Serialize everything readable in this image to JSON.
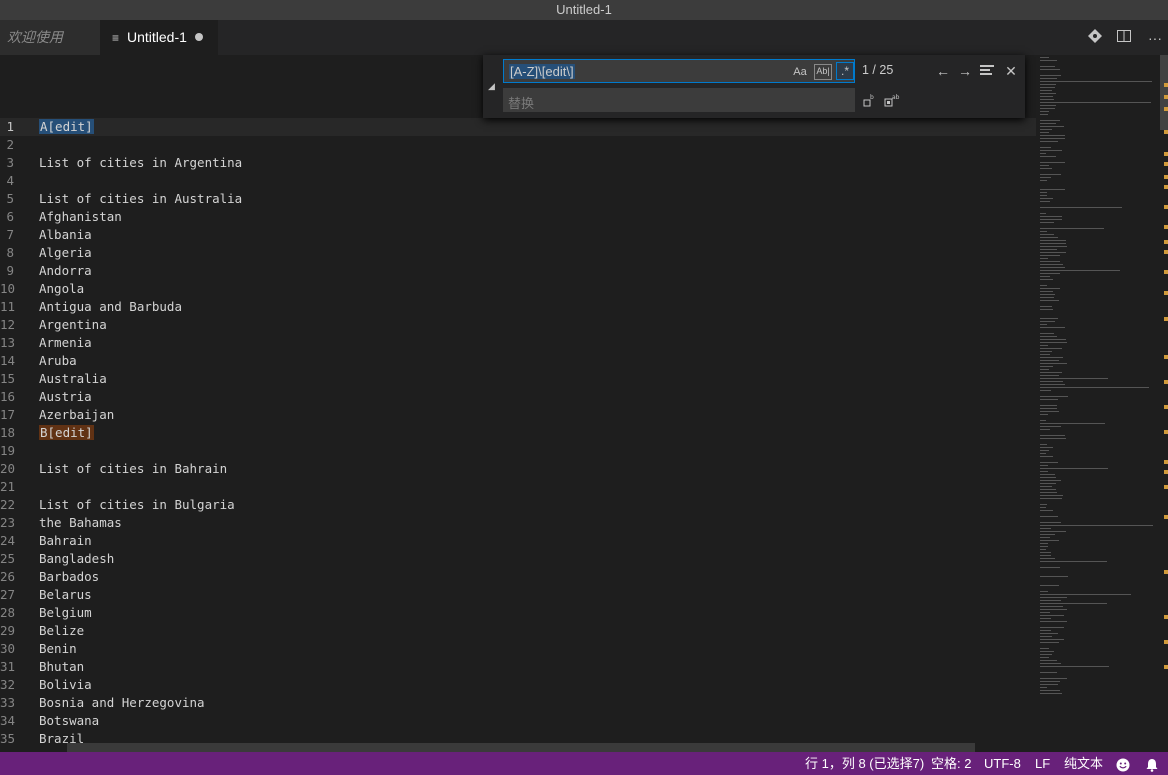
{
  "window": {
    "title": "Untitled-1"
  },
  "tabs": [
    {
      "label": "欢迎使用",
      "active": false
    },
    {
      "label": "Untitled-1",
      "active": true,
      "dirty": true
    }
  ],
  "tab_actions": [
    "source-control-icon",
    "split-editor-icon",
    "more-actions-icon"
  ],
  "find": {
    "query": "[A-Z]\\[edit\\]",
    "match_case_label": "Aa",
    "whole_word_label": "Ab|",
    "regex_label": ".*",
    "count": "1 / 25",
    "replace_placeholder": "替换"
  },
  "editor": {
    "lines": [
      "A[edit]",
      "",
      "List of cities in Argentina",
      "",
      "List of cities in Australia",
      "Afghanistan",
      "Albania",
      "Algeria",
      "Andorra",
      "Angola",
      "Antigua and Barbuda",
      "Argentina",
      "Armenia",
      "Aruba",
      "Australia",
      "Austria",
      "Azerbaijan",
      "B[edit]",
      "",
      "List of cities in Bahrain",
      "",
      "List of cities in Bulgaria",
      "the Bahamas",
      "Bahrain",
      "Bangladesh",
      "Barbados",
      "Belarus",
      "Belgium",
      "Belize",
      "Benin",
      "Bhutan",
      "Bolivia",
      "Bosnia and Herzegovina",
      "Botswana",
      "Brazil"
    ],
    "current_line": 1,
    "highlighted_lines": [
      1,
      18
    ]
  },
  "status": {
    "position": "行 1，列 8 (已选择7)",
    "indent": "空格: 2",
    "encoding": "UTF-8",
    "eol": "LF",
    "language": "纯文本"
  },
  "colors": {
    "statusbar": "#68217a",
    "selection": "#264f78",
    "other_match": "#613214",
    "accent": "#007acc"
  }
}
